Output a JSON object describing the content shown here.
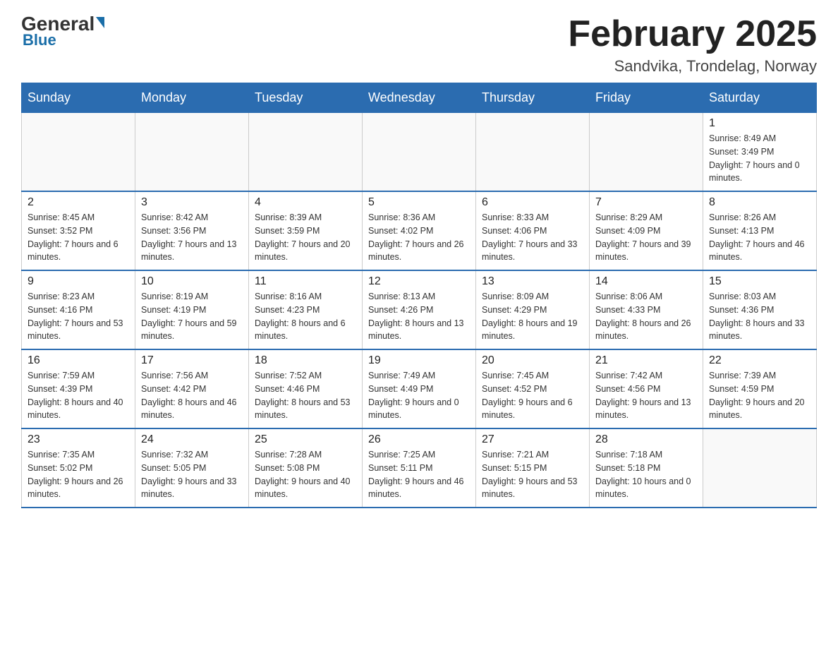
{
  "header": {
    "logo_general": "General",
    "logo_blue": "Blue",
    "calendar_title": "February 2025",
    "calendar_subtitle": "Sandvika, Trondelag, Norway"
  },
  "weekdays": [
    "Sunday",
    "Monday",
    "Tuesday",
    "Wednesday",
    "Thursday",
    "Friday",
    "Saturday"
  ],
  "weeks": [
    [
      {
        "day": "",
        "info": ""
      },
      {
        "day": "",
        "info": ""
      },
      {
        "day": "",
        "info": ""
      },
      {
        "day": "",
        "info": ""
      },
      {
        "day": "",
        "info": ""
      },
      {
        "day": "",
        "info": ""
      },
      {
        "day": "1",
        "info": "Sunrise: 8:49 AM\nSunset: 3:49 PM\nDaylight: 7 hours and 0 minutes."
      }
    ],
    [
      {
        "day": "2",
        "info": "Sunrise: 8:45 AM\nSunset: 3:52 PM\nDaylight: 7 hours and 6 minutes."
      },
      {
        "day": "3",
        "info": "Sunrise: 8:42 AM\nSunset: 3:56 PM\nDaylight: 7 hours and 13 minutes."
      },
      {
        "day": "4",
        "info": "Sunrise: 8:39 AM\nSunset: 3:59 PM\nDaylight: 7 hours and 20 minutes."
      },
      {
        "day": "5",
        "info": "Sunrise: 8:36 AM\nSunset: 4:02 PM\nDaylight: 7 hours and 26 minutes."
      },
      {
        "day": "6",
        "info": "Sunrise: 8:33 AM\nSunset: 4:06 PM\nDaylight: 7 hours and 33 minutes."
      },
      {
        "day": "7",
        "info": "Sunrise: 8:29 AM\nSunset: 4:09 PM\nDaylight: 7 hours and 39 minutes."
      },
      {
        "day": "8",
        "info": "Sunrise: 8:26 AM\nSunset: 4:13 PM\nDaylight: 7 hours and 46 minutes."
      }
    ],
    [
      {
        "day": "9",
        "info": "Sunrise: 8:23 AM\nSunset: 4:16 PM\nDaylight: 7 hours and 53 minutes."
      },
      {
        "day": "10",
        "info": "Sunrise: 8:19 AM\nSunset: 4:19 PM\nDaylight: 7 hours and 59 minutes."
      },
      {
        "day": "11",
        "info": "Sunrise: 8:16 AM\nSunset: 4:23 PM\nDaylight: 8 hours and 6 minutes."
      },
      {
        "day": "12",
        "info": "Sunrise: 8:13 AM\nSunset: 4:26 PM\nDaylight: 8 hours and 13 minutes."
      },
      {
        "day": "13",
        "info": "Sunrise: 8:09 AM\nSunset: 4:29 PM\nDaylight: 8 hours and 19 minutes."
      },
      {
        "day": "14",
        "info": "Sunrise: 8:06 AM\nSunset: 4:33 PM\nDaylight: 8 hours and 26 minutes."
      },
      {
        "day": "15",
        "info": "Sunrise: 8:03 AM\nSunset: 4:36 PM\nDaylight: 8 hours and 33 minutes."
      }
    ],
    [
      {
        "day": "16",
        "info": "Sunrise: 7:59 AM\nSunset: 4:39 PM\nDaylight: 8 hours and 40 minutes."
      },
      {
        "day": "17",
        "info": "Sunrise: 7:56 AM\nSunset: 4:42 PM\nDaylight: 8 hours and 46 minutes."
      },
      {
        "day": "18",
        "info": "Sunrise: 7:52 AM\nSunset: 4:46 PM\nDaylight: 8 hours and 53 minutes."
      },
      {
        "day": "19",
        "info": "Sunrise: 7:49 AM\nSunset: 4:49 PM\nDaylight: 9 hours and 0 minutes."
      },
      {
        "day": "20",
        "info": "Sunrise: 7:45 AM\nSunset: 4:52 PM\nDaylight: 9 hours and 6 minutes."
      },
      {
        "day": "21",
        "info": "Sunrise: 7:42 AM\nSunset: 4:56 PM\nDaylight: 9 hours and 13 minutes."
      },
      {
        "day": "22",
        "info": "Sunrise: 7:39 AM\nSunset: 4:59 PM\nDaylight: 9 hours and 20 minutes."
      }
    ],
    [
      {
        "day": "23",
        "info": "Sunrise: 7:35 AM\nSunset: 5:02 PM\nDaylight: 9 hours and 26 minutes."
      },
      {
        "day": "24",
        "info": "Sunrise: 7:32 AM\nSunset: 5:05 PM\nDaylight: 9 hours and 33 minutes."
      },
      {
        "day": "25",
        "info": "Sunrise: 7:28 AM\nSunset: 5:08 PM\nDaylight: 9 hours and 40 minutes."
      },
      {
        "day": "26",
        "info": "Sunrise: 7:25 AM\nSunset: 5:11 PM\nDaylight: 9 hours and 46 minutes."
      },
      {
        "day": "27",
        "info": "Sunrise: 7:21 AM\nSunset: 5:15 PM\nDaylight: 9 hours and 53 minutes."
      },
      {
        "day": "28",
        "info": "Sunrise: 7:18 AM\nSunset: 5:18 PM\nDaylight: 10 hours and 0 minutes."
      },
      {
        "day": "",
        "info": ""
      }
    ]
  ]
}
